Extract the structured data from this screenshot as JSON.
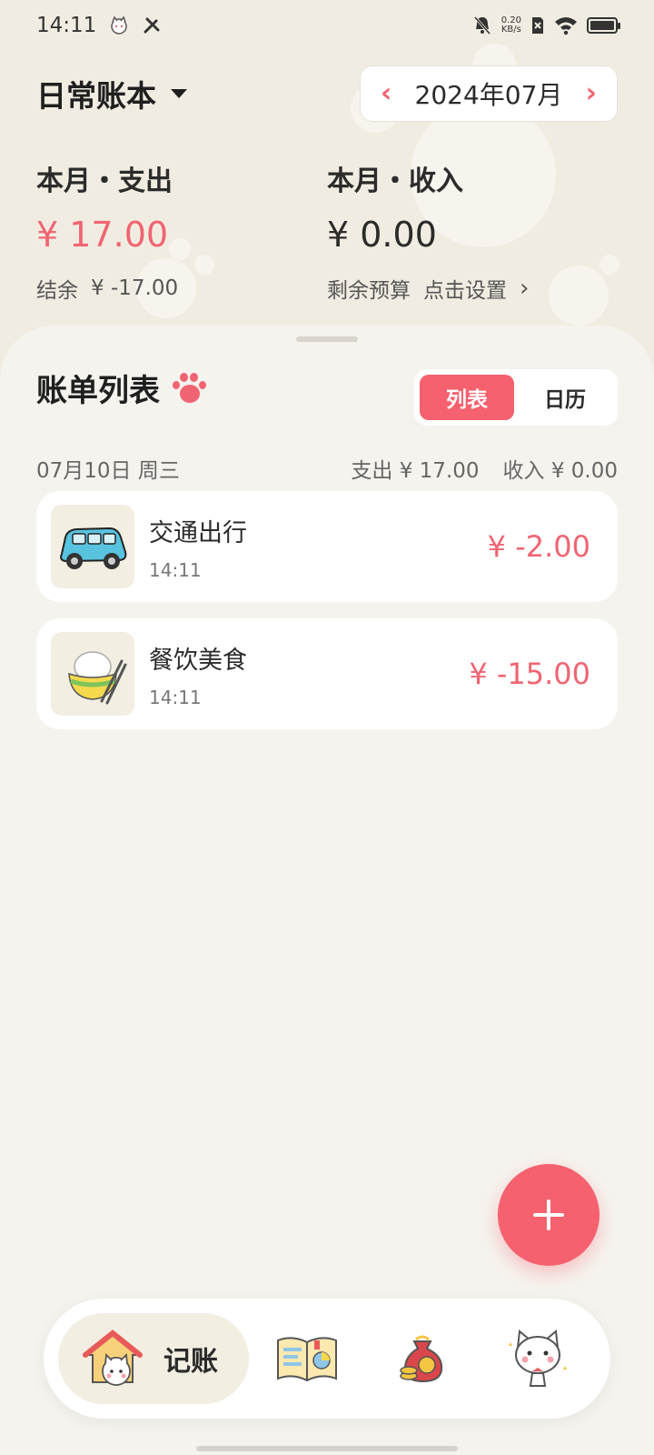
{
  "status_bar": {
    "time": "14:11",
    "net_speed_value": "0.20",
    "net_speed_unit": "KB/s",
    "icons": [
      "cat-notification-icon",
      "tools-icon",
      "mute-bell-icon",
      "sim-off-icon",
      "wifi-icon",
      "battery-icon"
    ]
  },
  "header": {
    "ledger_name": "日常账本",
    "month": "2024年07月"
  },
  "summary": {
    "expense_label": "本月・支出",
    "expense_amount": "¥ 17.00",
    "balance_label": "结余",
    "balance_value": "¥ -17.00",
    "income_label": "本月・收入",
    "income_amount": "¥ 0.00",
    "budget_label": "剩余预算",
    "budget_action": "点击设置"
  },
  "bill_list": {
    "title": "账单列表",
    "toggle": {
      "list": "列表",
      "calendar": "日历"
    },
    "days": [
      {
        "date": "07月10日 周三",
        "expense_total": "支出 ¥ 17.00",
        "income_total": "收入 ¥ 0.00",
        "items": [
          {
            "category": "交通出行",
            "time": "14:11",
            "amount": "¥ -2.00",
            "icon": "car-icon"
          },
          {
            "category": "餐饮美食",
            "time": "14:11",
            "amount": "¥ -15.00",
            "icon": "rice-bowl-icon"
          }
        ]
      }
    ]
  },
  "bottom_nav": {
    "active_label": "记账",
    "items": [
      "cat-house-icon",
      "statistics-book-icon",
      "money-bag-icon",
      "cat-profile-icon"
    ]
  },
  "colors": {
    "accent": "#f5616e",
    "expense": "#f06472",
    "background": "#f5f3ee",
    "header_bg": "#f1ece1"
  }
}
